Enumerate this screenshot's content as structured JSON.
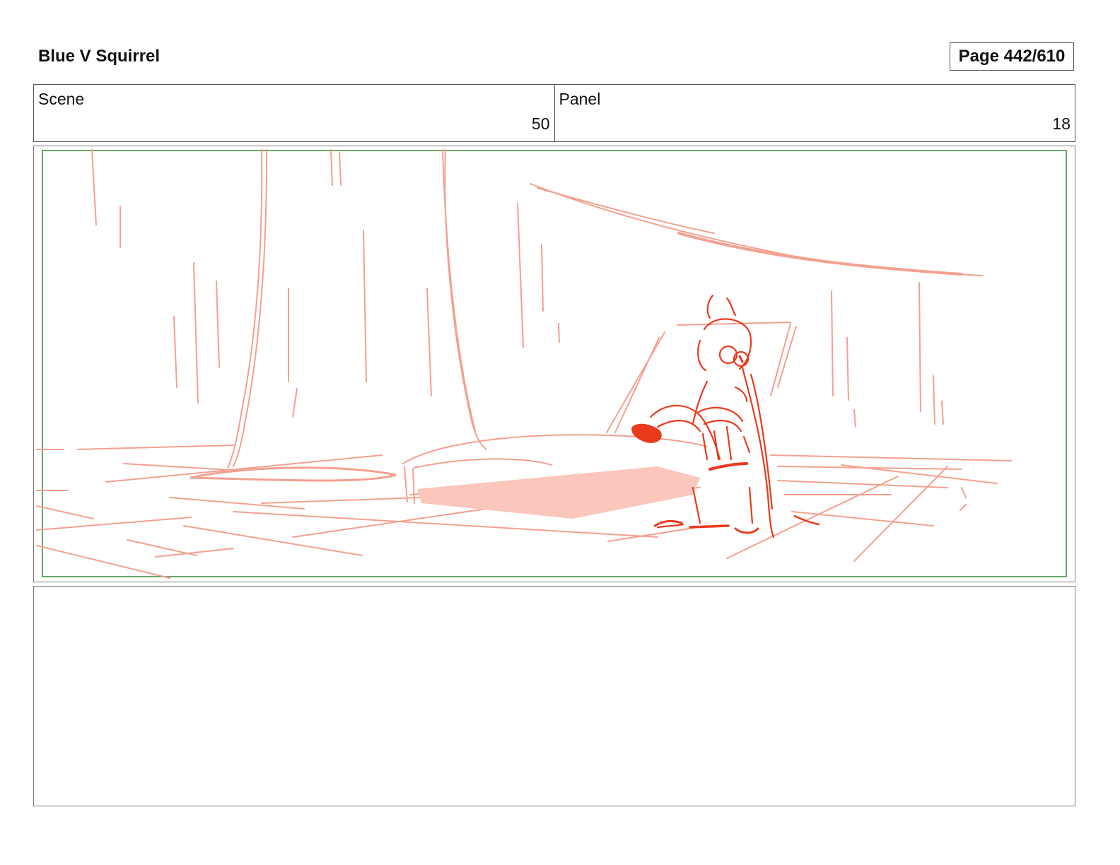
{
  "header": {
    "title": "Blue V Squirrel",
    "page_label": "Page 442/610"
  },
  "info": {
    "scene_label": "Scene",
    "scene_value": "50",
    "panel_label": "Panel",
    "panel_value": "18"
  },
  "colors": {
    "sketch_light": "#f4a090",
    "sketch_dark": "#ea3a1c",
    "safe_frame": "#3a8a3a"
  },
  "notes": {
    "text": ""
  }
}
